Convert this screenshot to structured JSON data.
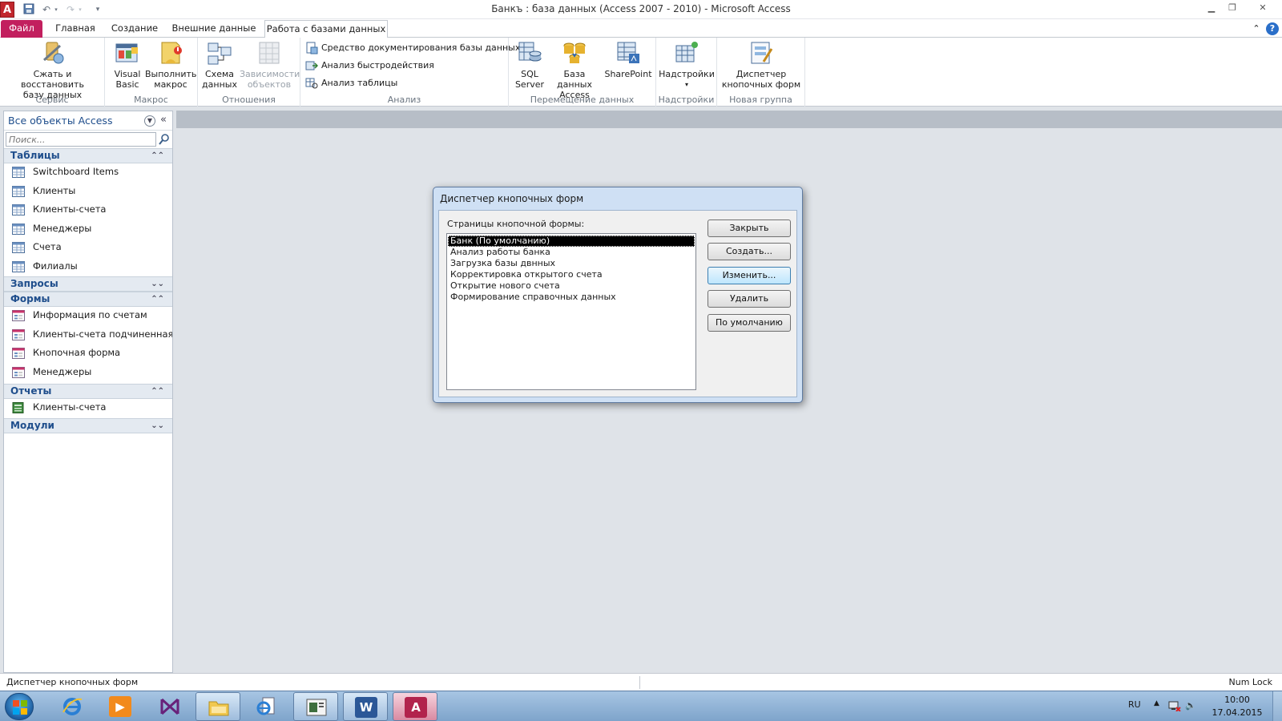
{
  "window": {
    "title": "Банкъ : база данных (Access 2007 - 2010)  -  Microsoft Access",
    "app_icon_letter": "A"
  },
  "ribbon_tabs": [
    "Файл",
    "Главная",
    "Создание",
    "Внешние данные",
    "Работа с базами данных"
  ],
  "ribbon": {
    "groups": {
      "service": "Сервис",
      "macro": "Макрос",
      "relations": "Отношения",
      "analysis": "Анализ",
      "move_data": "Перемещение данных",
      "addins": "Надстройки",
      "new_group": "Новая группа"
    },
    "buttons": {
      "compact_line1": "Сжать и восстановить",
      "compact_line2": "базу данных",
      "vb_line1": "Visual",
      "vb_line2": "Basic",
      "run_macro_line1": "Выполнить",
      "run_macro_line2": "макрос",
      "schema_line1": "Схема",
      "schema_line2": "данных",
      "deps_line1": "Зависимости",
      "deps_line2": "объектов",
      "doc_tool": "Средство документирования базы данных",
      "perf_analyzer": "Анализ быстродействия",
      "table_analyzer": "Анализ таблицы",
      "sql_line1": "SQL",
      "sql_line2": "Server",
      "access_db_line1": "База данных",
      "access_db_line2": "Access",
      "sharepoint": "SharePoint",
      "addins": "Надстройки",
      "switchboard_line1": "Диспетчер",
      "switchboard_line2": "кнопочных форм"
    }
  },
  "nav": {
    "title": "Все объекты Access",
    "search_placeholder": "Поиск...",
    "categories": {
      "tables": "Таблицы",
      "queries": "Запросы",
      "forms": "Формы",
      "reports": "Отчеты",
      "modules": "Модули"
    },
    "tables": [
      "Switchboard Items",
      "Клиенты",
      "Клиенты-счета",
      "Менеджеры",
      "Счета",
      "Филиалы"
    ],
    "forms": [
      "Информация по счетам",
      "Клиенты-счета подчиненная ...",
      "Кнопочная форма",
      "Менеджеры"
    ],
    "reports": [
      "Клиенты-счета"
    ]
  },
  "dialog": {
    "title": "Диспетчер кнопочных форм",
    "list_label": "Страницы кнопочной формы:",
    "pages": [
      "Банк (По умолчанию)",
      "Анализ работы банка",
      "Загрузка базы двнных",
      "Корректировка открытого счета",
      "Открытие нового счета",
      "Формирование справочных данных"
    ],
    "selected_index": 0,
    "buttons": {
      "close": "Закрыть",
      "create": "Создать...",
      "edit": "Изменить...",
      "delete": "Удалить",
      "default": "По умолчанию"
    }
  },
  "statusbar": {
    "left": "Диспетчер кнопочных форм",
    "right": "Num Lock"
  },
  "taskbar": {
    "lang": "RU",
    "time": "10:00",
    "date": "17.04.2015",
    "word_letter": "W",
    "access_letter": "A"
  },
  "colors": {
    "file_tab": "#c21f5e",
    "nav_title": "#1f4e8c",
    "dialog_frame": "#cfe0f4",
    "selection": "#000000"
  }
}
